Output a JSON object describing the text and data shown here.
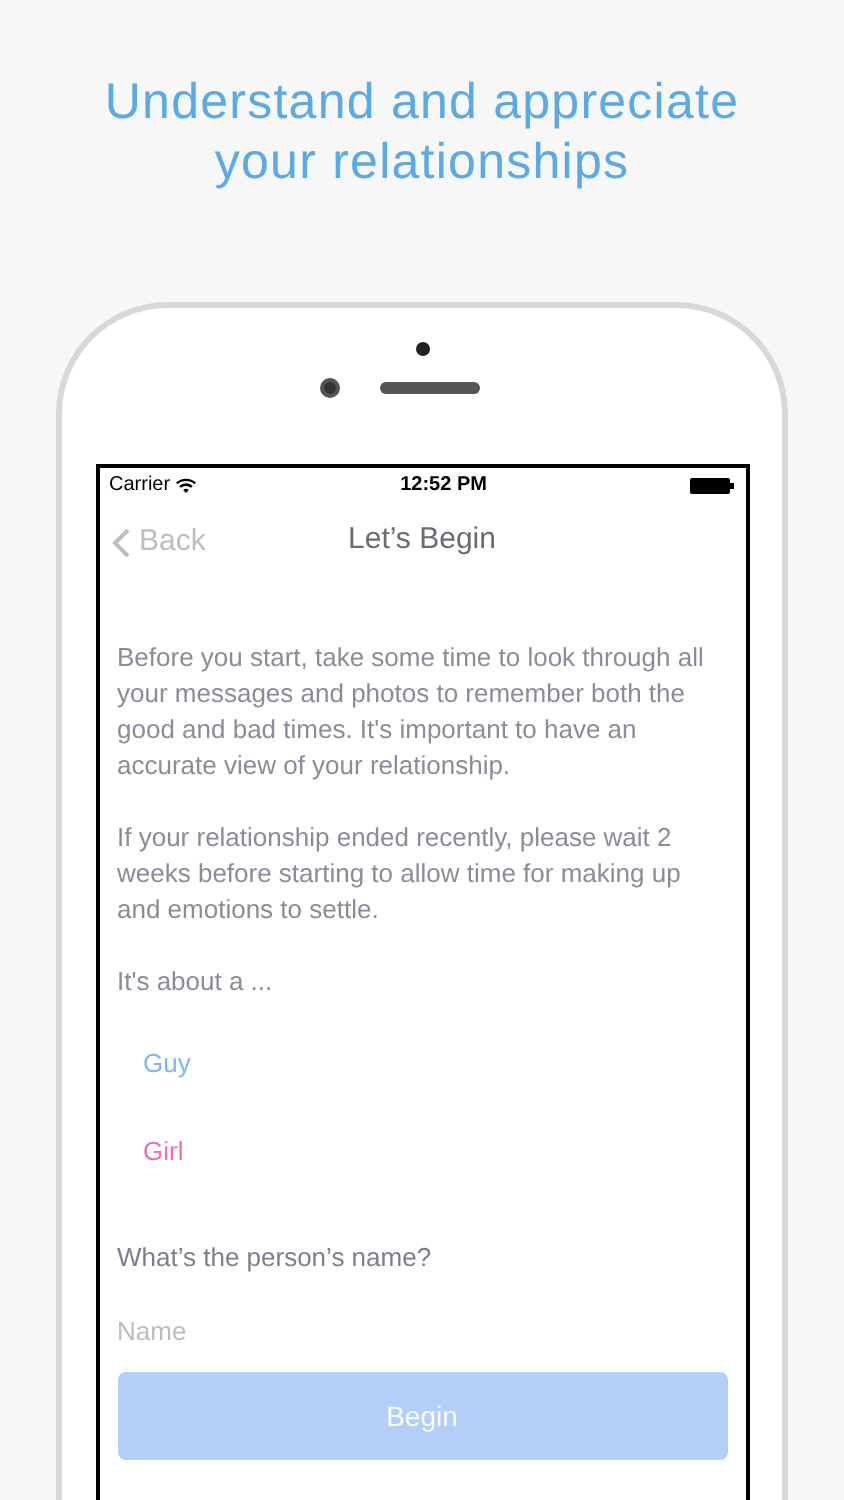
{
  "headline": "Understand and appreciate your relationships",
  "status_bar": {
    "carrier": "Carrier",
    "time": "12:52 PM"
  },
  "nav": {
    "back": "Back",
    "title": "Let’s Begin"
  },
  "intro": [
    "Before you start, take some time to look through all your messages and photos to remember both the good and bad times. It's important to have an accurate view of your relationship.",
    "If your relationship ended recently, please wait 2 weeks before starting to allow time for making up and emotions to settle."
  ],
  "choice_prompt": "It's about a ...",
  "choices": [
    {
      "label": "Guy",
      "color": "#7fb6ee"
    },
    {
      "label": "Girl",
      "color": "#ee6fb5"
    }
  ],
  "name_prompt": "What’s the person’s name?",
  "name_field": {
    "placeholder": "Name"
  },
  "begin_button": {
    "label": "Begin",
    "disabled": true
  }
}
